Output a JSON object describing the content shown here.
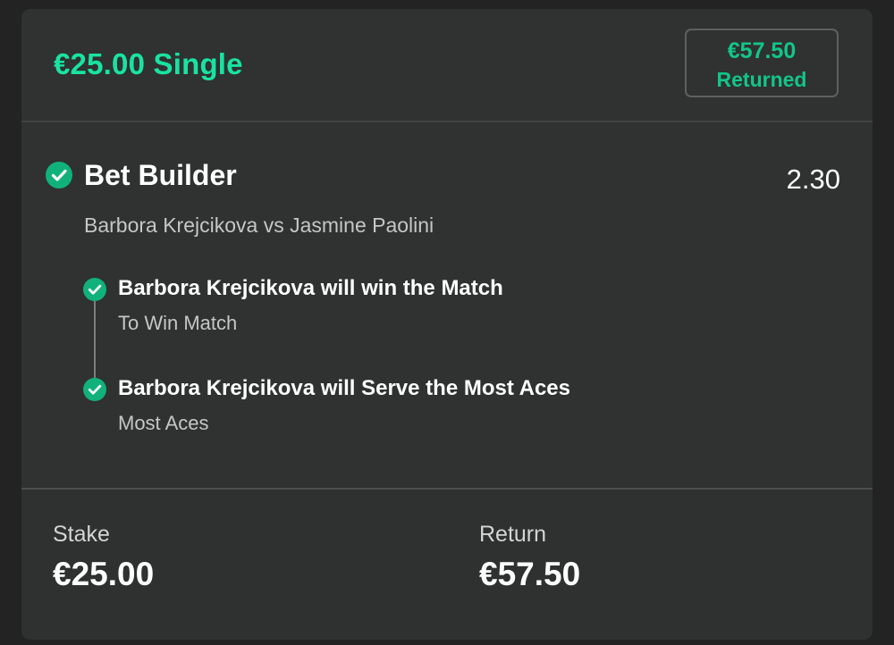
{
  "header": {
    "bet_title": "€25.00 Single",
    "returned_amount": "€57.50",
    "returned_label": "Returned"
  },
  "leg": {
    "title": "Bet Builder",
    "odds": "2.30",
    "match": "Barbora Krejcikova vs Jasmine Paolini",
    "status_icon": "check-circle-icon",
    "selections": [
      {
        "name": "Barbora Krejcikova will win the Match",
        "market": "To Win Match",
        "status_icon": "check-circle-icon"
      },
      {
        "name": "Barbora Krejcikova will Serve the Most Aces",
        "market": "Most Aces",
        "status_icon": "check-circle-icon"
      }
    ]
  },
  "footer": {
    "stake_label": "Stake",
    "stake_value": "€25.00",
    "return_label": "Return",
    "return_value": "€57.50"
  },
  "colors": {
    "accent": "#19e3a2",
    "returned": "#13c58b",
    "check": "#11b17c",
    "card_bg": "#2f3230",
    "page_bg": "#222322"
  }
}
